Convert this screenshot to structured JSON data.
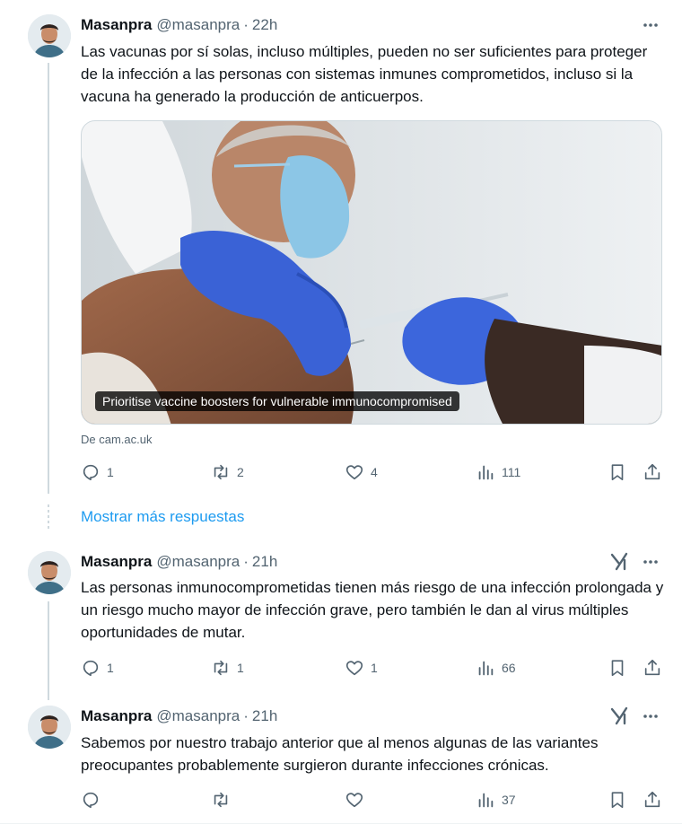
{
  "tweets": [
    {
      "name": "Masanpra",
      "handle": "@masanpra",
      "separator": "·",
      "time": "22h",
      "text": "Las vacunas por sí solas, incluso múltiples, pueden no ser suficientes para proteger de la infección a las personas con sistemas inmunes comprometidos, incluso si la vacuna ha generado la producción de anticuerpos.",
      "card": {
        "caption": "Prioritise vaccine boosters for vulnerable immunocompromised",
        "source": "De cam.ac.uk"
      },
      "replies": "1",
      "retweets": "2",
      "likes": "4",
      "views": "111"
    },
    {
      "name": "Masanpra",
      "handle": "@masanpra",
      "separator": "·",
      "time": "21h",
      "text": "Las personas inmunocomprometidas tienen más riesgo de una infección prolongada y un riesgo mucho mayor de infección grave, pero también le dan al virus múltiples oportunidades de mutar.",
      "replies": "1",
      "retweets": "1",
      "likes": "1",
      "views": "66"
    },
    {
      "name": "Masanpra",
      "handle": "@masanpra",
      "separator": "·",
      "time": "21h",
      "text": "Sabemos por nuestro trabajo anterior que al menos algunas de las variantes preocupantes probablemente surgieron durante infecciones crónicas.",
      "replies": "",
      "retweets": "",
      "likes": "",
      "views": "37"
    }
  ],
  "show_more_replies": "Mostrar más respuestas",
  "icons": {
    "reply": "reply-icon",
    "retweet": "retweet-icon",
    "like": "heart-icon",
    "views": "views-icon",
    "bookmark": "bookmark-icon",
    "share": "share-icon",
    "more": "more-icon",
    "grok": "grok-icon"
  },
  "colors": {
    "text": "#0f1419",
    "muted": "#536471",
    "link": "#1d9bf0",
    "border": "#cfd9de"
  }
}
